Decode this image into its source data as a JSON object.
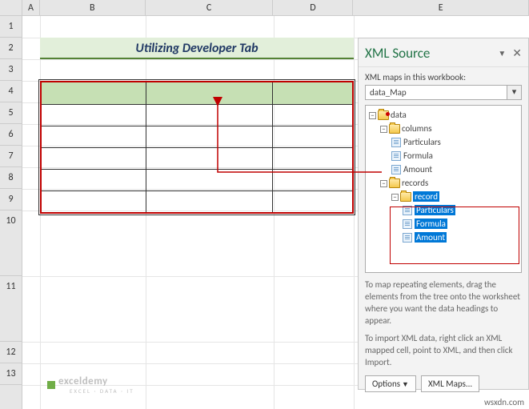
{
  "columns": {
    "A": "A",
    "B": "B",
    "C": "C",
    "D": "D",
    "E": "E"
  },
  "rows": [
    "1",
    "2",
    "3",
    "4",
    "5",
    "6",
    "7",
    "8",
    "9",
    "10",
    "11",
    "12",
    "13"
  ],
  "title": "Utilizing Developer Tab",
  "xmlpane": {
    "title": "XML Source",
    "maps_label": "XML maps in this workbook:",
    "selected_map": "data_Map",
    "tree": {
      "root": "data",
      "group1": "columns",
      "g1_items": [
        "Particulars",
        "Formula",
        "Amount"
      ],
      "group2": "records",
      "g2_child": "record",
      "g2_items": [
        "Particulars",
        "Formula",
        "Amount"
      ]
    },
    "help1": "To map repeating elements, drag the elements from the tree onto the worksheet where you want the data headings to appear.",
    "help2": "To import XML data, right click an XML mapped cell, point to XML, and then click Import.",
    "btn_options": "Options",
    "btn_maps": "XML Maps..."
  },
  "watermark": {
    "name": "exceldemy",
    "sub": "EXCEL · DATA · IT"
  },
  "footer": "wsxdn.com"
}
